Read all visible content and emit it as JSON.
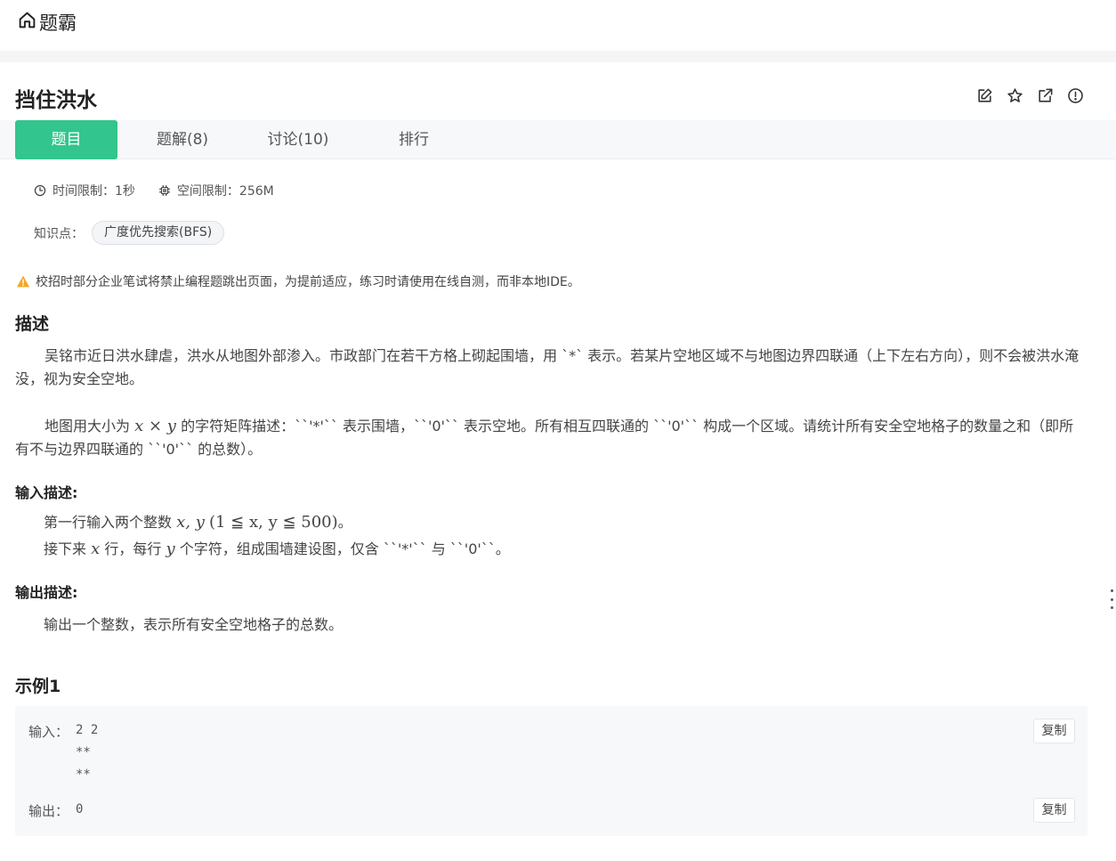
{
  "header": {
    "brand": "题霸",
    "brand_icon": "home-icon"
  },
  "problem": {
    "title": "挡住洪水",
    "actions": [
      "edit-icon",
      "star-icon",
      "share-icon",
      "report-icon"
    ]
  },
  "tabs": [
    {
      "label": "题目",
      "active": true
    },
    {
      "label": "题解(8)",
      "active": false
    },
    {
      "label": "讨论(10)",
      "active": false
    },
    {
      "label": "排行",
      "active": false
    }
  ],
  "limits": {
    "time": "时间限制：1秒",
    "space": "空间限制：256M"
  },
  "knowledge": {
    "label": "知识点：",
    "tags": [
      "广度优先搜索(BFS)"
    ]
  },
  "notice": "校招时部分企业笔试将禁止编程题跳出页面，为提前适应，练习时请使用在线自测，而非本地IDE。",
  "description": {
    "heading": "描述",
    "para1": "吴铭市近日洪水肆虐，洪水从地图外部渗入。市政部门在若干方格上砌起围墙，用 `*` 表示。若某片空地区域不与地图边界四联通（上下左右方向），则不会被洪水淹没，视为安全空地。",
    "para2_pre": "地图用大小为",
    "para2_math": "x × y",
    "para2_post": "的字符矩阵描述：``'*'`` 表示围墙，``'0'`` 表示空地。所有相互四联通的 ``'0'`` 构成一个区域。请统计所有安全空地格子的数量之和（即所有不与边界四联通的 ``'0'`` 的总数）。"
  },
  "input": {
    "heading": "输入描述:",
    "line1_pre": "第一行输入两个整数",
    "line1_math_vars": "x, y",
    "line1_math_range": "(1 ≦ x, y ≦ 500)",
    "line1_post": "。",
    "line2_pre": "接下来",
    "line2_x": "x",
    "line2_mid1": "行，每行",
    "line2_y": "y",
    "line2_mid2": "个字符，组成围墙建设图，仅含 ``'*'`` 与 ``'0'``。"
  },
  "output": {
    "heading": "输出描述:",
    "line1": "输出一个整数，表示所有安全空地格子的总数。"
  },
  "example": {
    "heading": "示例1",
    "input_label": "输入：",
    "input_value": "2 2\n**\n**",
    "output_label": "输出：",
    "output_value": "0",
    "copy_label": "复制"
  },
  "colors": {
    "accent": "#32c58d",
    "warning": "#f5a623"
  }
}
